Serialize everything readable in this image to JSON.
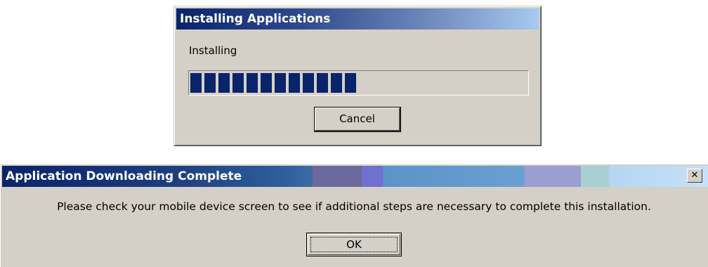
{
  "install_dialog": {
    "title": "Installing Applications",
    "status_text": "Installing",
    "progress_fraction": 0.5,
    "cancel_label": "Cancel"
  },
  "complete_dialog": {
    "title": "Application Downloading Complete",
    "close_glyph": "✕",
    "message": "Please check your mobile device screen to see if additional steps are necessary to complete this installation.",
    "ok_label": "OK"
  },
  "colors": {
    "title_bar_active": "#0a246a",
    "dialog_face": "#d4d0c8",
    "progress_block": "#0a246a"
  },
  "icons": {
    "close": "close-icon"
  }
}
